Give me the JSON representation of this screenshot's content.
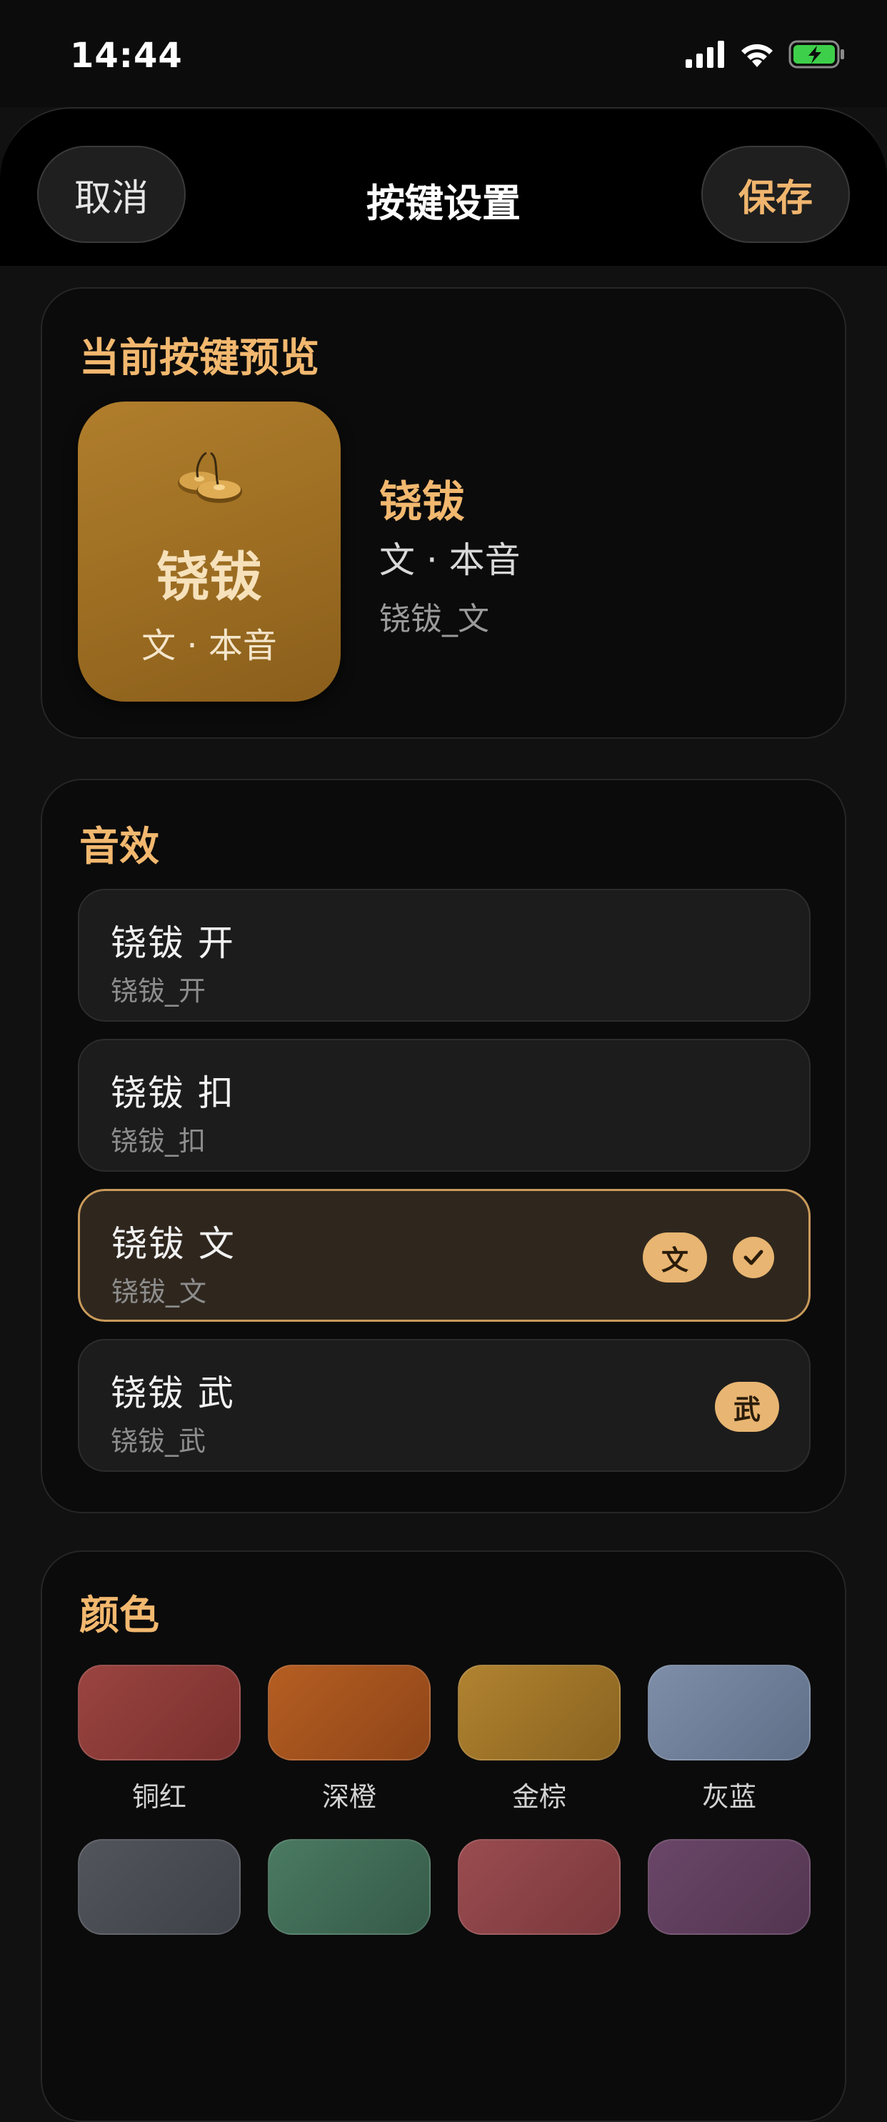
{
  "status": {
    "time": "14:44"
  },
  "header": {
    "cancel_label": "取消",
    "title": "按键设置",
    "save_label": "保存"
  },
  "preview": {
    "section_title": "当前按键预览",
    "key_name": "铙钹",
    "key_sub": "文 · 本音",
    "name": "铙钹",
    "type": "文 · 本音",
    "file": "铙钹_文",
    "key_color": "#a67628",
    "accent_color": "#f2b86f"
  },
  "sounds": {
    "section_title": "音效",
    "items": [
      {
        "name": "铙钹 开",
        "file": "铙钹_开",
        "tag": "",
        "selected": false
      },
      {
        "name": "铙钹 扣",
        "file": "铙钹_扣",
        "tag": "",
        "selected": false
      },
      {
        "name": "铙钹 文",
        "file": "铙钹_文",
        "tag": "文",
        "selected": true
      },
      {
        "name": "铙钹 武",
        "file": "铙钹_武",
        "tag": "武",
        "selected": false
      }
    ]
  },
  "colors": {
    "section_title": "颜色",
    "swatches": [
      {
        "label": "铜红",
        "color": "#8a3a36"
      },
      {
        "label": "深橙",
        "color": "#a65420"
      },
      {
        "label": "金棕",
        "color": "#a0762a"
      },
      {
        "label": "灰蓝",
        "color": "#6f7f98"
      },
      {
        "label": "",
        "color": "#484b52"
      },
      {
        "label": "",
        "color": "#3f6a56"
      },
      {
        "label": "",
        "color": "#8a4448"
      },
      {
        "label": "",
        "color": "#5e3f5e"
      }
    ]
  }
}
